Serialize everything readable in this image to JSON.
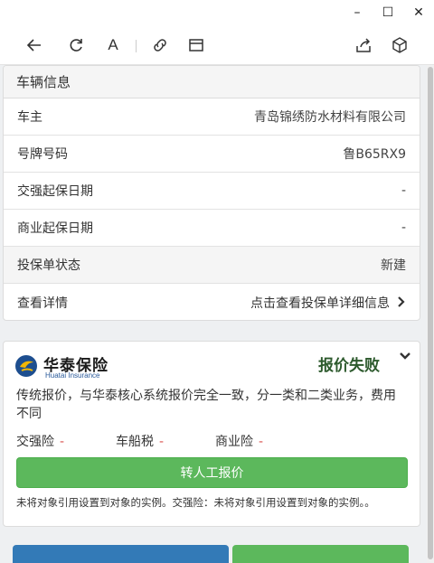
{
  "window": {
    "controls": {
      "minimize": "–",
      "maximize": "☐",
      "close": "✕"
    }
  },
  "toolbar": {
    "icons": [
      "back-icon",
      "refresh-icon",
      "font-size-icon",
      "link-icon",
      "window-icon",
      "share-icon",
      "package-icon"
    ],
    "font_label": "A"
  },
  "vehicle_info": {
    "header": "车辆信息",
    "rows": [
      {
        "label": "车主",
        "value": "青岛锦绣防水材料有限公司"
      },
      {
        "label": "号牌号码",
        "value": "鲁B65RX9"
      },
      {
        "label": "交强起保日期",
        "value": "-"
      },
      {
        "label": "商业起保日期",
        "value": "-"
      },
      {
        "label": "投保单状态",
        "value": "新建"
      },
      {
        "label": "查看详情",
        "value": "点击查看投保单详细信息"
      }
    ]
  },
  "insurer": {
    "logo_name": "华泰保险",
    "logo_sub": "Huatai Insurance",
    "status": "报价失败",
    "description": "传统报价，与华泰核心系统报价完全一致，分一类和二类业务，费用不同",
    "fees": [
      {
        "label": "交强险",
        "value": "-"
      },
      {
        "label": "车船税",
        "value": "-"
      },
      {
        "label": "商业险",
        "value": "-"
      }
    ],
    "manual_button": "转人工报价",
    "note": "未将对象引用设置到对象的实例。交强险：未将对象引用设置到对象的实例。。"
  },
  "colors": {
    "primary": "#337ab7",
    "success": "#5cb85c",
    "danger": "#d9534f",
    "status_text": "#2d5a2d"
  }
}
